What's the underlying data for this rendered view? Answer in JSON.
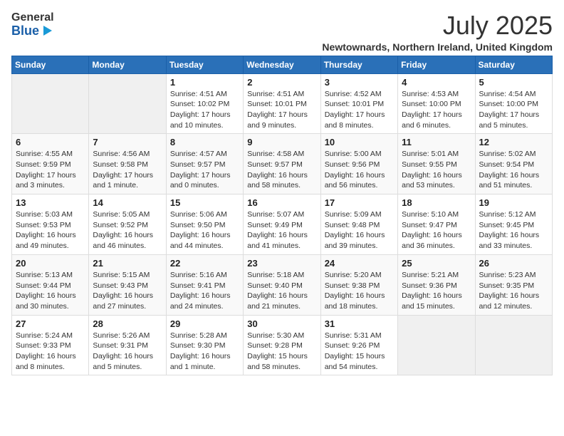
{
  "logo": {
    "general": "General",
    "blue": "Blue"
  },
  "title": {
    "month_year": "July 2025",
    "location": "Newtownards, Northern Ireland, United Kingdom"
  },
  "weekdays": [
    "Sunday",
    "Monday",
    "Tuesday",
    "Wednesday",
    "Thursday",
    "Friday",
    "Saturday"
  ],
  "weeks": [
    [
      {
        "day": "",
        "info": ""
      },
      {
        "day": "",
        "info": ""
      },
      {
        "day": "1",
        "sunrise": "4:51 AM",
        "sunset": "10:02 PM",
        "daylight": "17 hours and 10 minutes."
      },
      {
        "day": "2",
        "sunrise": "4:51 AM",
        "sunset": "10:01 PM",
        "daylight": "17 hours and 9 minutes."
      },
      {
        "day": "3",
        "sunrise": "4:52 AM",
        "sunset": "10:01 PM",
        "daylight": "17 hours and 8 minutes."
      },
      {
        "day": "4",
        "sunrise": "4:53 AM",
        "sunset": "10:00 PM",
        "daylight": "17 hours and 6 minutes."
      },
      {
        "day": "5",
        "sunrise": "4:54 AM",
        "sunset": "10:00 PM",
        "daylight": "17 hours and 5 minutes."
      }
    ],
    [
      {
        "day": "6",
        "sunrise": "4:55 AM",
        "sunset": "9:59 PM",
        "daylight": "17 hours and 3 minutes."
      },
      {
        "day": "7",
        "sunrise": "4:56 AM",
        "sunset": "9:58 PM",
        "daylight": "17 hours and 1 minute."
      },
      {
        "day": "8",
        "sunrise": "4:57 AM",
        "sunset": "9:57 PM",
        "daylight": "17 hours and 0 minutes."
      },
      {
        "day": "9",
        "sunrise": "4:58 AM",
        "sunset": "9:57 PM",
        "daylight": "16 hours and 58 minutes."
      },
      {
        "day": "10",
        "sunrise": "5:00 AM",
        "sunset": "9:56 PM",
        "daylight": "16 hours and 56 minutes."
      },
      {
        "day": "11",
        "sunrise": "5:01 AM",
        "sunset": "9:55 PM",
        "daylight": "16 hours and 53 minutes."
      },
      {
        "day": "12",
        "sunrise": "5:02 AM",
        "sunset": "9:54 PM",
        "daylight": "16 hours and 51 minutes."
      }
    ],
    [
      {
        "day": "13",
        "sunrise": "5:03 AM",
        "sunset": "9:53 PM",
        "daylight": "16 hours and 49 minutes."
      },
      {
        "day": "14",
        "sunrise": "5:05 AM",
        "sunset": "9:52 PM",
        "daylight": "16 hours and 46 minutes."
      },
      {
        "day": "15",
        "sunrise": "5:06 AM",
        "sunset": "9:50 PM",
        "daylight": "16 hours and 44 minutes."
      },
      {
        "day": "16",
        "sunrise": "5:07 AM",
        "sunset": "9:49 PM",
        "daylight": "16 hours and 41 minutes."
      },
      {
        "day": "17",
        "sunrise": "5:09 AM",
        "sunset": "9:48 PM",
        "daylight": "16 hours and 39 minutes."
      },
      {
        "day": "18",
        "sunrise": "5:10 AM",
        "sunset": "9:47 PM",
        "daylight": "16 hours and 36 minutes."
      },
      {
        "day": "19",
        "sunrise": "5:12 AM",
        "sunset": "9:45 PM",
        "daylight": "16 hours and 33 minutes."
      }
    ],
    [
      {
        "day": "20",
        "sunrise": "5:13 AM",
        "sunset": "9:44 PM",
        "daylight": "16 hours and 30 minutes."
      },
      {
        "day": "21",
        "sunrise": "5:15 AM",
        "sunset": "9:43 PM",
        "daylight": "16 hours and 27 minutes."
      },
      {
        "day": "22",
        "sunrise": "5:16 AM",
        "sunset": "9:41 PM",
        "daylight": "16 hours and 24 minutes."
      },
      {
        "day": "23",
        "sunrise": "5:18 AM",
        "sunset": "9:40 PM",
        "daylight": "16 hours and 21 minutes."
      },
      {
        "day": "24",
        "sunrise": "5:20 AM",
        "sunset": "9:38 PM",
        "daylight": "16 hours and 18 minutes."
      },
      {
        "day": "25",
        "sunrise": "5:21 AM",
        "sunset": "9:36 PM",
        "daylight": "16 hours and 15 minutes."
      },
      {
        "day": "26",
        "sunrise": "5:23 AM",
        "sunset": "9:35 PM",
        "daylight": "16 hours and 12 minutes."
      }
    ],
    [
      {
        "day": "27",
        "sunrise": "5:24 AM",
        "sunset": "9:33 PM",
        "daylight": "16 hours and 8 minutes."
      },
      {
        "day": "28",
        "sunrise": "5:26 AM",
        "sunset": "9:31 PM",
        "daylight": "16 hours and 5 minutes."
      },
      {
        "day": "29",
        "sunrise": "5:28 AM",
        "sunset": "9:30 PM",
        "daylight": "16 hours and 1 minute."
      },
      {
        "day": "30",
        "sunrise": "5:30 AM",
        "sunset": "9:28 PM",
        "daylight": "15 hours and 58 minutes."
      },
      {
        "day": "31",
        "sunrise": "5:31 AM",
        "sunset": "9:26 PM",
        "daylight": "15 hours and 54 minutes."
      },
      {
        "day": "",
        "info": ""
      },
      {
        "day": "",
        "info": ""
      }
    ]
  ]
}
